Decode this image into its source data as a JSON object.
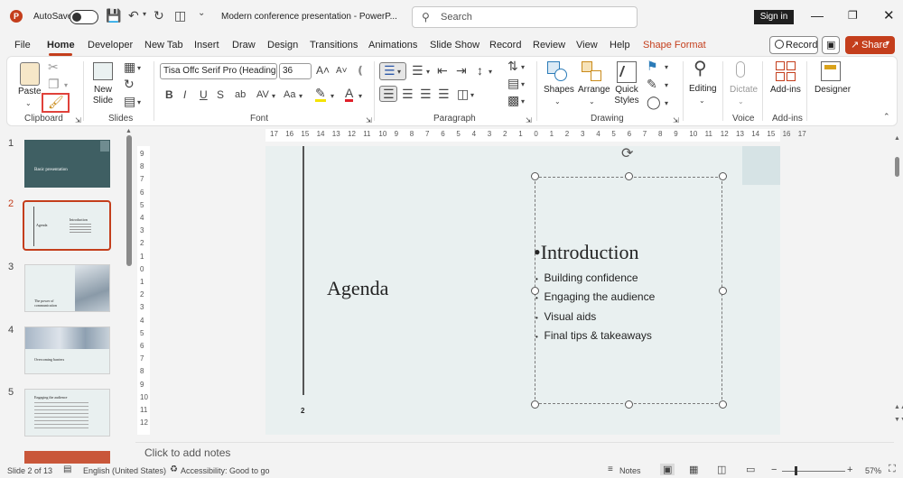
{
  "titlebar": {
    "autosave_label": "AutoSave",
    "doc_title": "Modern conference presentation  -  PowerP...",
    "search_placeholder": "Search",
    "signin_label": "Sign in"
  },
  "tabs": [
    {
      "label": "File"
    },
    {
      "label": "Home"
    },
    {
      "label": "Developer"
    },
    {
      "label": "New Tab"
    },
    {
      "label": "Insert"
    },
    {
      "label": "Draw"
    },
    {
      "label": "Design"
    },
    {
      "label": "Transitions"
    },
    {
      "label": "Animations"
    },
    {
      "label": "Slide Show"
    },
    {
      "label": "Record"
    },
    {
      "label": "Review"
    },
    {
      "label": "View"
    },
    {
      "label": "Help"
    },
    {
      "label": "Shape Format"
    }
  ],
  "tab_actions": {
    "record_label": "Record",
    "share_label": "Share"
  },
  "ribbon": {
    "clipboard": {
      "paste_label": "Paste",
      "group_label": "Clipboard"
    },
    "slides": {
      "new_slide_label": "New Slide",
      "group_label": "Slides"
    },
    "font": {
      "font_name": "Tisa Offc Serif Pro (Headings)",
      "font_size": "36",
      "group_label": "Font"
    },
    "paragraph": {
      "group_label": "Paragraph"
    },
    "drawing": {
      "shapes_label": "Shapes",
      "arrange_label": "Arrange",
      "quick_styles_label": "Quick Styles",
      "group_label": "Drawing"
    },
    "editing": {
      "label": "Editing"
    },
    "voice": {
      "dictate_label": "Dictate",
      "group_label": "Voice"
    },
    "addins": {
      "label": "Add-ins",
      "group_label": "Add-ins"
    },
    "designer": {
      "label": "Designer"
    }
  },
  "slides_pane": {
    "thumbs": [
      {
        "num": "1",
        "title": "Basic presentation"
      },
      {
        "num": "2",
        "title": "Agenda",
        "subtitle": "Introduction"
      },
      {
        "num": "3",
        "title": "The power of communication"
      },
      {
        "num": "4",
        "title": "Overcoming barriers"
      },
      {
        "num": "5",
        "title": "Engaging the audience"
      }
    ]
  },
  "ruler": {
    "h_ticks": [
      "17",
      "16",
      "15",
      "14",
      "13",
      "12",
      "11",
      "10",
      "9",
      "8",
      "7",
      "6",
      "5",
      "4",
      "3",
      "2",
      "1",
      "0",
      "1",
      "2",
      "3",
      "4",
      "5",
      "6",
      "7",
      "8",
      "9",
      "10",
      "11",
      "12",
      "13",
      "14",
      "15",
      "16",
      "17"
    ],
    "v_ticks": [
      "9",
      "8",
      "7",
      "6",
      "5",
      "4",
      "3",
      "2",
      "1",
      "0",
      "1",
      "2",
      "3",
      "4",
      "5",
      "6",
      "7",
      "8",
      "9",
      "10",
      "11",
      "12"
    ]
  },
  "slide": {
    "title": "Agenda",
    "page_number": "2",
    "heading": "Introduction",
    "bullets": [
      "Building confidence",
      "Engaging the audience",
      "Visual aids",
      "Final tips & takeaways"
    ]
  },
  "notes_placeholder": "Click to add notes",
  "status": {
    "slide_info": "Slide 2 of 13",
    "language": "English (United States)",
    "accessibility": "Accessibility: Good to go",
    "notes_label": "Notes",
    "zoom": "57%"
  },
  "colors": {
    "accent": "#c43e1c",
    "slide_bg": "#e9f0f0",
    "title_thumb": "#3f5f63"
  }
}
